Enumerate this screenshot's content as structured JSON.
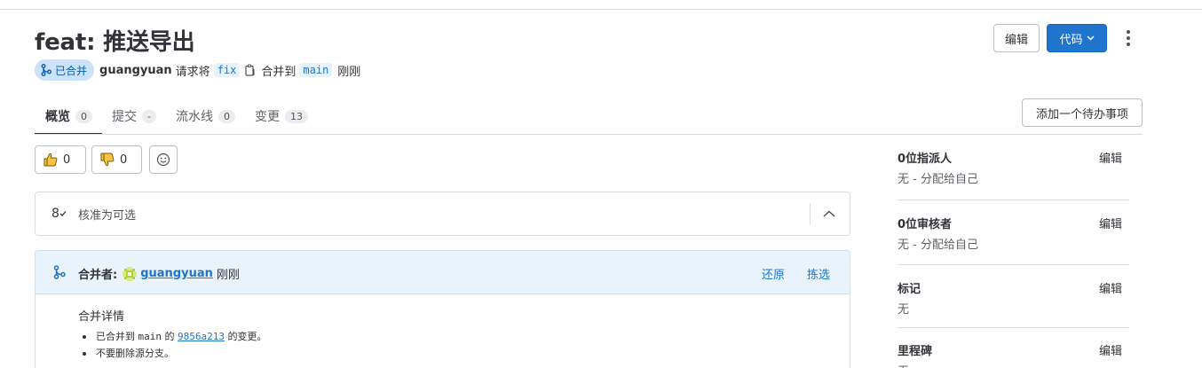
{
  "header": {
    "title": "feat: 推送导出",
    "status": "已合并",
    "author": "guangyuan",
    "request_text": "请求将",
    "source_branch": "fix",
    "merge_text": "合并到",
    "target_branch": "main",
    "time": "刚刚",
    "edit_label": "编辑",
    "code_label": "代码"
  },
  "tabs": [
    {
      "label": "概览",
      "count": "0"
    },
    {
      "label": "提交",
      "count": "-"
    },
    {
      "label": "流水线",
      "count": "0"
    },
    {
      "label": "变更",
      "count": "13"
    }
  ],
  "todo_label": "添加一个待办事项",
  "reactions": {
    "thumbs_up": "0",
    "thumbs_down": "0"
  },
  "approval": {
    "label": "核准为可选",
    "count": "8"
  },
  "merged": {
    "label": "合并者:",
    "user": "guangyuan",
    "time": "刚刚",
    "revert": "还原",
    "cherry_pick": "拣选",
    "details_title": "合并详情",
    "detail1_prefix": "已合并到",
    "detail1_branch": "main",
    "detail1_of": "的",
    "detail1_sha": "9856a213",
    "detail1_suffix": "的变更。",
    "detail2": "不要删除源分支。"
  },
  "sidebar": [
    {
      "title": "0位指派人",
      "value": "无 - 分配给自己",
      "edit": "编辑"
    },
    {
      "title": "0位审核者",
      "value": "无 - 分配给自己",
      "edit": "编辑"
    },
    {
      "title": "标记",
      "value": "无",
      "edit": "编辑"
    },
    {
      "title": "里程碑",
      "value": "无",
      "edit": "编辑"
    }
  ],
  "colors": {
    "accent": "#1f75cb",
    "merged_badge_bg": "#cbe2f9",
    "merged_widget_bg": "#e9f3fc"
  }
}
